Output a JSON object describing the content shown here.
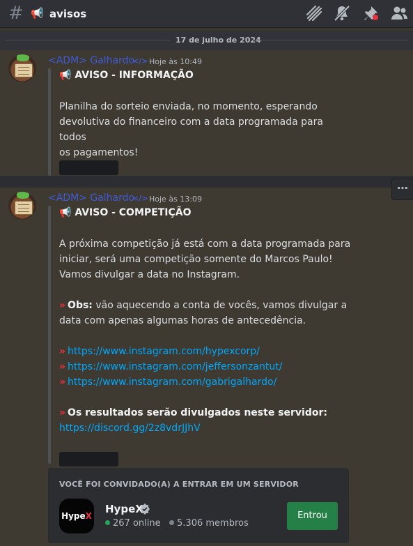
{
  "header": {
    "hash": "#",
    "channel_emoji": "📢",
    "channel_name": "avisos",
    "icons": [
      "threads-icon",
      "mute-bell-icon",
      "pin-icon",
      "members-icon"
    ]
  },
  "divider": {
    "date": "17 de julho de 2024"
  },
  "messages": [
    {
      "author": "<ADM> Galhardo",
      "dev_badge": "</>",
      "time": "Hoje às 10:49",
      "title_emoji": "📢",
      "title": "AVISO - INFORMAÇÃO",
      "lines": [
        "Planilha do sorteio enviada, no momento, esperando",
        "devolutiva do financeiro com a data programada para todos",
        "os pagamentos!"
      ]
    },
    {
      "author": "<ADM> Galhardo",
      "dev_badge": "</>",
      "time": "Hoje às 13:09",
      "title_emoji": "📢",
      "title": "AVISO - COMPETIÇÃO",
      "intro": [
        "A próxima competição já está com a data programada para",
        "iniciar, será uma competição somente do Marcos Paulo!",
        "Vamos divulgar a data no Instagram."
      ],
      "obs_label": "Obs:",
      "obs_rest_1": " vão aquecendo a conta de vocês, vamos divulgar a",
      "obs_rest_2": "data com apenas algumas horas de antecedência.",
      "links": [
        "https://www.instagram.com/hypexcorp/",
        "https://www.instagram.com/jeffersonzantut/",
        "https://www.instagram.com/gabrigalhardo/"
      ],
      "results_label": "Os resultados serão divulgados neste servidor:",
      "discord_link": "https://discord.gg/2z8vdrJJhV",
      "more_label": "⋯"
    }
  ],
  "arrow_glyph": "»",
  "invite": {
    "heading": "VOCÊ FOI CONVIDADO(A) A ENTRAR EM UM SERVIDOR",
    "server_logo_text_1": "Hype",
    "server_logo_text_2": "X",
    "server_name": "HypeX",
    "online": "267 online",
    "members": "5.306 membros",
    "button_label": "Entrou",
    "online_color": "#23a55a",
    "members_color": "#80848e",
    "button_color": "#248046"
  }
}
